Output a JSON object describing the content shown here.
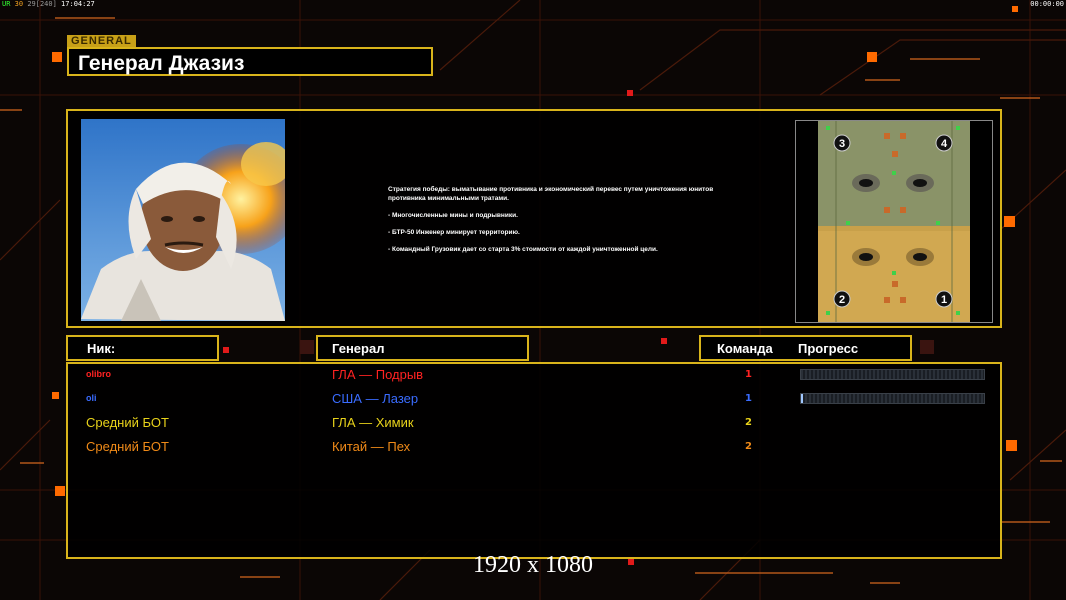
{
  "hud": {
    "prefix": "UR",
    "fps": "30",
    "fps_cap": "29[240]",
    "clock": "17:04:27",
    "timer": "00:00:00"
  },
  "general_tag": "GENERAL",
  "general_name": "Генерал Джазиз",
  "description": {
    "strategy": "Стратегия победы: выматывание противника и экономический перевес путем уничтожения юнитов противника минимальными тратами.",
    "bullets": [
      "- Многочисленные мины и подрывники.",
      "- БТР-50 Инженер минирует территорию.",
      "- Командный Грузовик дает со старта 3% стоимости от каждой уничтоженной цели."
    ]
  },
  "map": {
    "start_positions": [
      "3",
      "4",
      "2",
      "1"
    ]
  },
  "headers": {
    "nick": "Ник:",
    "general": "Генерал",
    "team": "Команда",
    "progress": "Прогресс"
  },
  "players": [
    {
      "nick": "olibro",
      "general": "ГЛА — Подрыв",
      "team": "1",
      "color": "#ff2222",
      "progress": 0,
      "show_progress": true
    },
    {
      "nick": "oli",
      "general": "США — Лазер",
      "team": "1",
      "color": "#3a6cff",
      "progress": 0.01,
      "show_progress": true
    },
    {
      "nick": "Средний БОТ",
      "general": "ГЛА — Химик",
      "team": "2",
      "color": "#e8d21a",
      "show_progress": false
    },
    {
      "nick": "Средний БОТ",
      "general": "Китай — Пех",
      "team": "2",
      "color": "#f08a18",
      "show_progress": false
    }
  ],
  "resolution_label": "1920 x 1080",
  "colors": {
    "accent": "#d9b41b",
    "orange_square": "#ff6a00",
    "background": "#0b0605"
  }
}
